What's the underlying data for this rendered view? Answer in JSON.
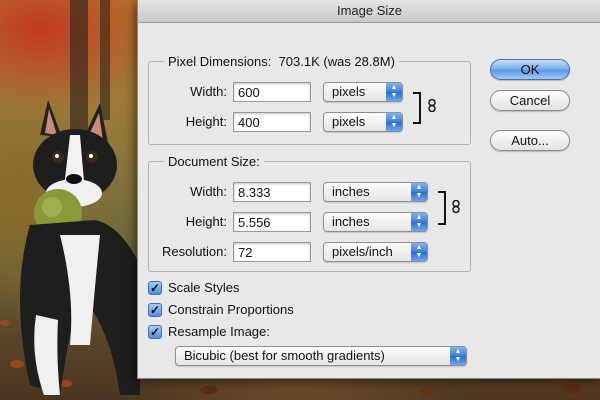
{
  "window": {
    "title": "Image Size"
  },
  "pixel_dimensions": {
    "label": "Pixel Dimensions:",
    "size_text": "703.1K (was 28.8M)",
    "width": {
      "label": "Width:",
      "value": "600",
      "unit": "pixels"
    },
    "height": {
      "label": "Height:",
      "value": "400",
      "unit": "pixels"
    }
  },
  "document_size": {
    "label": "Document Size:",
    "width": {
      "label": "Width:",
      "value": "8.333",
      "unit": "inches"
    },
    "height": {
      "label": "Height:",
      "value": "5.556",
      "unit": "inches"
    },
    "resolution": {
      "label": "Resolution:",
      "value": "72",
      "unit": "pixels/inch"
    }
  },
  "options": {
    "scale_styles": {
      "label": "Scale Styles",
      "checked": true
    },
    "constrain_proportions": {
      "label": "Constrain Proportions",
      "checked": true
    },
    "resample_image": {
      "label": "Resample Image:",
      "checked": true
    },
    "resample_method": "Bicubic (best for smooth gradients)"
  },
  "buttons": {
    "ok": "OK",
    "cancel": "Cancel",
    "auto": "Auto..."
  },
  "colors": {
    "accent": "#5b98e8",
    "dialog_bg": "#e8e8e8"
  }
}
